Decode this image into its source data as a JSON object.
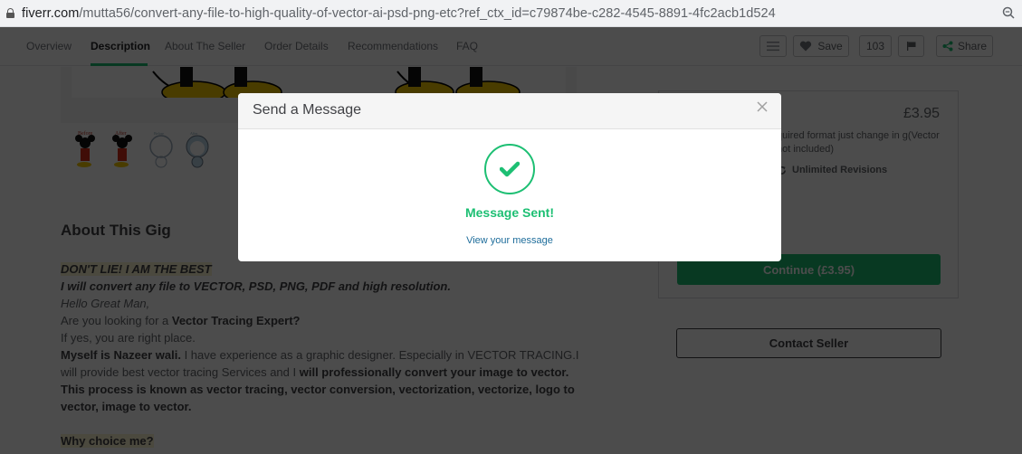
{
  "browser": {
    "url_host": "fiverr.com",
    "url_path": "/mutta56/convert-any-file-to-high-quality-of-vector-ai-psd-png-etc?ref_ctx_id=c79874be-c282-4545-8891-4fc2acb1d524"
  },
  "nav": {
    "tabs": [
      {
        "label": "Overview"
      },
      {
        "label": "Description"
      },
      {
        "label": "About The Seller"
      },
      {
        "label": "Order Details"
      },
      {
        "label": "Recommendations"
      },
      {
        "label": "FAQ"
      }
    ],
    "active_tab": "Description",
    "save_label": "Save",
    "save_count": "103",
    "share_label": "Share"
  },
  "gallery": {
    "thumbs": [
      {
        "caption": "Before"
      },
      {
        "caption": "After"
      },
      {
        "caption": "Before"
      },
      {
        "caption": "After"
      }
    ]
  },
  "about": {
    "title": "About This Gig",
    "line1": "DON'T LIE! I AM THE BEST",
    "line2": "I will convert any file to VECTOR, PSD, PNG, PDF and high resolution.",
    "line3": "Hello Great Man,",
    "line4_pre": "Are you looking for a ",
    "line4_bold": "Vector Tracing Expert?",
    "line5": "If yes, you are right place.",
    "line6_bold": "Myself is Nazeer wali.",
    "line6_rest": " I have experience as a graphic designer. Especially in VECTOR TRACING.I will provide best vector tracing Services and I ",
    "line6_bold2": "will professionally convert your image to vector. This process is known as vector tracing, vector conversion, vectorization, vectorize, logo to vector, image to vector.",
    "why_title": "Why choice me?"
  },
  "package": {
    "price": "£3.95",
    "description": "quired format just change in g(Vector not included)",
    "revisions": "Unlimited Revisions",
    "continue_label": "Continue (£3.95)",
    "contact_label": "Contact Seller"
  },
  "modal": {
    "title": "Send a Message",
    "status": "Message Sent!",
    "link": "View your message"
  },
  "colors": {
    "brand_green": "#1dbf73",
    "link_blue": "#1e6d9b"
  }
}
